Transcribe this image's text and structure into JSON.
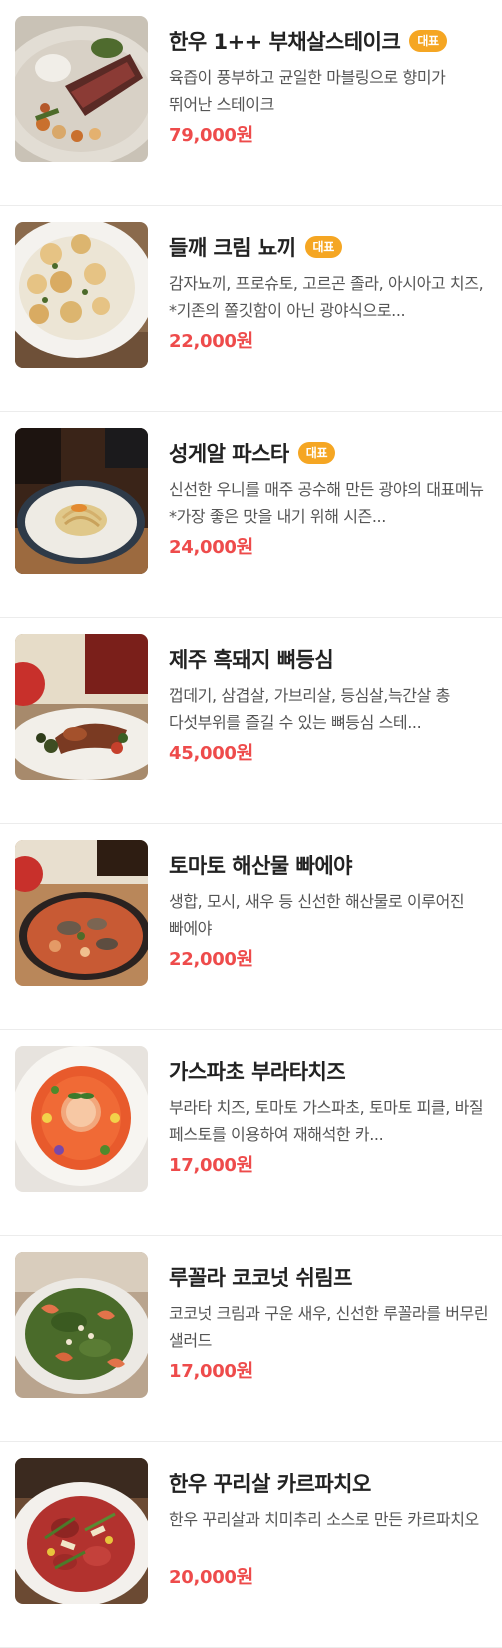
{
  "menu": {
    "items": [
      {
        "name": "한우 1++ 부채살스테이크",
        "badge": "대표",
        "description": "육즙이 풍부하고 균일한 마블링으로 향미가 뛰어난 스테이크",
        "price": "79,000원",
        "photo_icon": "steak-photo"
      },
      {
        "name": "들깨 크림 뇨끼",
        "badge": "대표",
        "description": "감자뇨끼, 프로슈토, 고르곤 졸라, 아시아고 치즈, *기존의 쫄깃함이 아닌 광야식으로...",
        "price": "22,000원",
        "photo_icon": "gnocchi-photo"
      },
      {
        "name": "성게알 파스타",
        "badge": "대표",
        "description": "신선한 우니를 매주 공수해 만든 광야의 대표메뉴 *가장 좋은 맛을 내기 위해 시즌...",
        "price": "24,000원",
        "photo_icon": "pasta-photo"
      },
      {
        "name": "제주 흑돼지 뼈등심",
        "badge": "",
        "description": "껍데기, 삼겹살, 가브리살, 등심살,늑간살 총 다섯부위를 즐길 수 있는 뼈등심 스테...",
        "price": "45,000원",
        "photo_icon": "pork-photo"
      },
      {
        "name": "토마토 해산물 빠에야",
        "badge": "",
        "description": "생합, 모시, 새우 등 신선한 해산물로 이루어진 빠에야",
        "price": "22,000원",
        "photo_icon": "paella-photo"
      },
      {
        "name": "가스파초 부라타치즈",
        "badge": "",
        "description": "부라타 치즈, 토마토 가스파초, 토마토 피클, 바질 페스토를 이용하여 재해석한 카...",
        "price": "17,000원",
        "photo_icon": "burrata-photo"
      },
      {
        "name": "루꼴라 코코넛 쉬림프",
        "badge": "",
        "description": "코코넛 크림과 구운 새우, 신선한 루꼴라를 버무린 샐러드",
        "price": "17,000원",
        "photo_icon": "shrimp-salad-photo"
      },
      {
        "name": "한우 꾸리살 카르파치오",
        "badge": "",
        "description": "한우 꾸리살과 치미추리 소스로 만든 카르파치오",
        "price": "20,000원",
        "photo_icon": "carpaccio-photo"
      }
    ]
  },
  "colors": {
    "price": "#ee4b4b",
    "badge_bg": "#f5a623",
    "divider": "#ececec"
  }
}
